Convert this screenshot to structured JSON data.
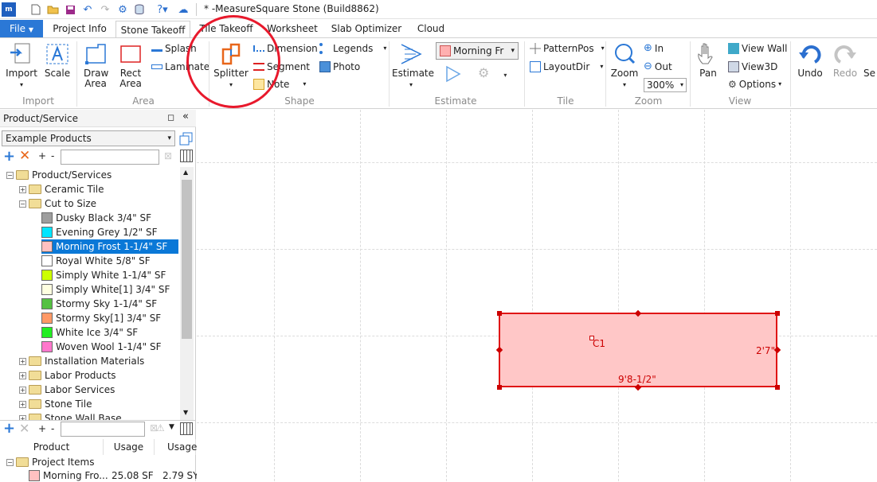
{
  "window": {
    "title": "* -MeasureSquare Stone (Build8862)",
    "app_icon": "app-logo-icon"
  },
  "tabs": [
    {
      "label": "File"
    },
    {
      "label": "Project Info"
    },
    {
      "label": "Stone Takeoff"
    },
    {
      "label": "Tile Takeoff"
    },
    {
      "label": "Worksheet"
    },
    {
      "label": "Slab Optimizer"
    },
    {
      "label": "Cloud"
    }
  ],
  "ribbon": {
    "import_label": "Import",
    "scale_label": "Scale",
    "group_import": "Import",
    "draw_area_label": "Draw Area",
    "rect_area_label": "Rect Area",
    "splash_label": "Splash",
    "laminate_label": "Laminate",
    "group_area": "Area",
    "splitter_label": "Splitter",
    "dimension_label": "Dimension",
    "segment_label": "Segment",
    "note_label": "Note",
    "legends_label": "Legends",
    "photo_label": "Photo",
    "group_shape": "Shape",
    "estimate_label": "Estimate",
    "material_selected": "Morning Fr",
    "material_color": "#ffb0b0",
    "group_estimate": "Estimate",
    "patternpos_label": "PatternPos",
    "layoutdir_label": "LayoutDir",
    "group_tile": "Tile",
    "zoom_label": "Zoom",
    "zoom_in_label": "In",
    "zoom_out_label": "Out",
    "zoom_value": "300%",
    "group_zoom": "Zoom",
    "pan_label": "Pan",
    "view_wall_label": "View Wall",
    "view3d_label": "View3D",
    "options_label": "Options",
    "group_view": "View",
    "undo_label": "Undo",
    "redo_label": "Redo",
    "sel_label": "Se"
  },
  "left_panel": {
    "title": "Product/Service",
    "dropdown_value": "Example Products",
    "search_placeholder": "",
    "tree": {
      "root": "Product/Services",
      "ceramic": "Ceramic Tile",
      "cut_to_size": "Cut to Size",
      "items": [
        {
          "label": "Dusky Black  3/4\" SF",
          "color": "#9e9e9e"
        },
        {
          "label": "Evening Grey  1/2\" SF",
          "color": "#00e5ff"
        },
        {
          "label": "Morning Frost  1-1/4\" SF",
          "color": "#ffc1c1"
        },
        {
          "label": "Royal White  5/8\" SF",
          "color": "#ffffff"
        },
        {
          "label": "Simply White  1-1/4\" SF",
          "color": "#ccff00"
        },
        {
          "label": "Simply White[1]  3/4\" SF",
          "color": "#ffffe0"
        },
        {
          "label": "Stormy Sky  1-1/4\" SF",
          "color": "#55c142"
        },
        {
          "label": "Stormy Sky[1]  3/4\" SF",
          "color": "#ff9966"
        },
        {
          "label": "White Ice  3/4\" SF",
          "color": "#22ee22"
        },
        {
          "label": "Woven Wool  1-1/4\" SF",
          "color": "#ff77cc"
        }
      ],
      "installation": "Installation Materials",
      "labor_products": "Labor Products",
      "labor_services": "Labor Services",
      "stone_tile": "Stone Tile",
      "stone_wall_base": "Stone Wall Base"
    },
    "bottom": {
      "col_product": "Product",
      "col_usage": "Usage",
      "col_usage2": "Usage",
      "project_items": "Project Items",
      "row_product": "Morning Fro...",
      "row_usage": "25.08 SF",
      "row_usage2": "2.79 SY"
    }
  },
  "canvas": {
    "shape_label": "C1",
    "dim_bottom": "9'8-1/2\"",
    "dim_right": "2'7\""
  }
}
